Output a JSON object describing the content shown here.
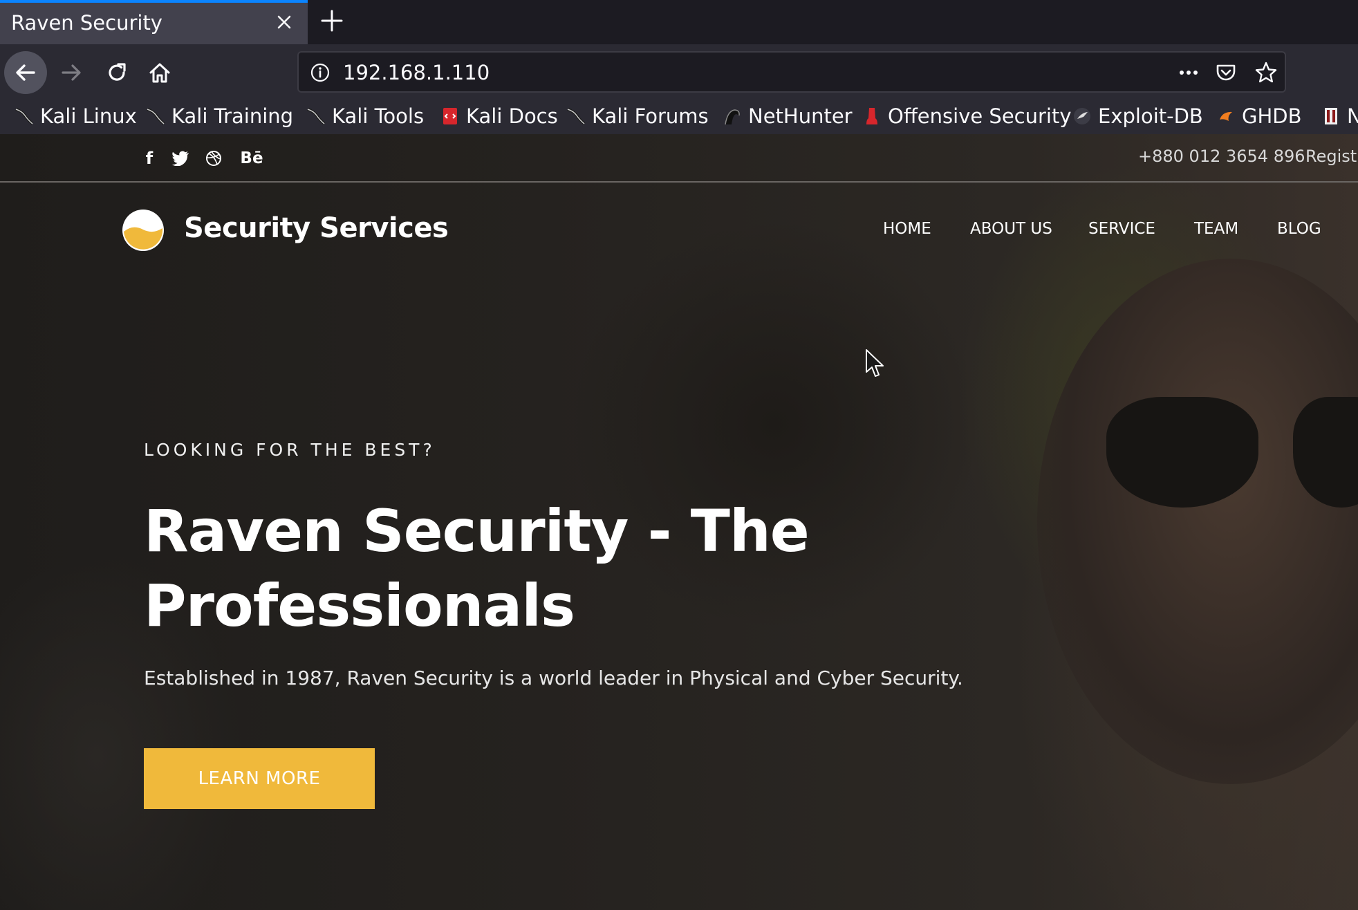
{
  "browser": {
    "tab_title": "Raven Security",
    "url": "192.168.1.110",
    "active_tab_color": "#0a84ff",
    "icons": [
      "close-icon",
      "plus-icon",
      "back-arrow-icon",
      "forward-arrow-icon",
      "reload-icon",
      "home-icon",
      "info-icon",
      "more-icon",
      "pocket-icon",
      "star-icon"
    ]
  },
  "bookmarks": [
    {
      "label": "Kali Linux",
      "icon": "kali-dragon-icon"
    },
    {
      "label": "Kali Training",
      "icon": "kali-dragon-icon"
    },
    {
      "label": "Kali Tools",
      "icon": "kali-dragon-icon"
    },
    {
      "label": "Kali Docs",
      "icon": "kali-docs-icon"
    },
    {
      "label": "Kali Forums",
      "icon": "kali-dragon-icon"
    },
    {
      "label": "NetHunter",
      "icon": "nethunter-icon"
    },
    {
      "label": "Offensive Security",
      "icon": "offsec-icon"
    },
    {
      "label": "Exploit-DB",
      "icon": "exploitdb-icon"
    },
    {
      "label": "GHDB",
      "icon": "ghdb-icon"
    },
    {
      "label": "N",
      "icon": "msfu-icon"
    }
  ],
  "site": {
    "social": [
      "f",
      "twitter",
      "dribbble",
      "Bē"
    ],
    "phone": "+880 012 3654 896",
    "register": "Regist",
    "brand": "Security Services",
    "menu": [
      "HOME",
      "ABOUT US",
      "SERVICE",
      "TEAM",
      "BLOG"
    ],
    "hero": {
      "eyebrow": "LOOKING FOR THE BEST?",
      "headline": "Raven Security - The Professionals",
      "subtext": "Established in 1987, Raven Security is a world leader in Physical and Cyber Security.",
      "cta": "LEARN MORE"
    },
    "accent_color": "#f0b93b"
  }
}
